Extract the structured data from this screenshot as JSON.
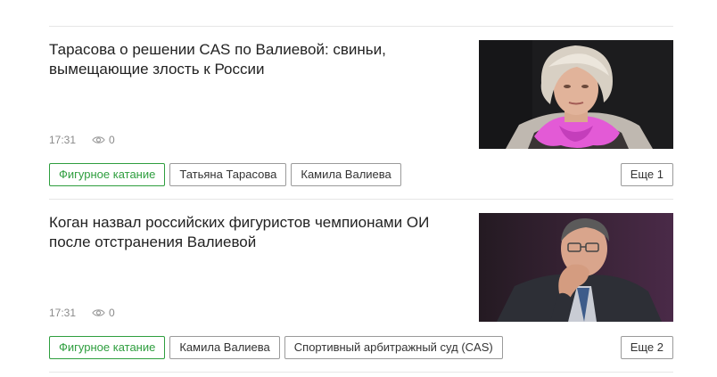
{
  "articles": [
    {
      "title": "Тарасова о решении CAS по Валиевой: свиньи, вымещающие злость к России",
      "time": "17:31",
      "views": "0",
      "tags": [
        "Фигурное катание",
        "Татьяна Тарасова",
        "Камила Валиева"
      ],
      "more": "Еще 1"
    },
    {
      "title": "Коган назвал российских фигуристов чемпионами ОИ после отстранения Валиевой",
      "time": "17:31",
      "views": "0",
      "tags": [
        "Фигурное катание",
        "Камила Валиева",
        "Спортивный арбитражный суд (CAS)"
      ],
      "more": "Еще 2"
    }
  ],
  "icons": {
    "views": "eye-icon"
  },
  "colors": {
    "accent": "#2e9e3e",
    "divider": "#e6e6e6",
    "meta_text": "#8a8a8a"
  }
}
